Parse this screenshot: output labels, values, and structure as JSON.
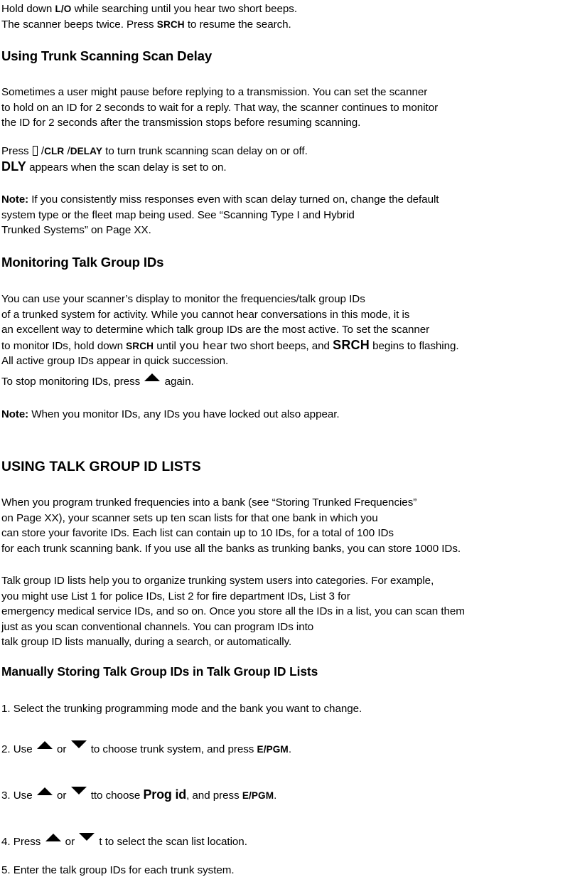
{
  "document": {
    "type": "scanner-owners-manual-page",
    "paragraphs": {
      "intro": {
        "line1_a": "Hold down ",
        "line1_key": "L/O",
        "line1_b": " while searching until you hear two short beeps.",
        "line2_a": "The scanner beeps twice. Press ",
        "line2_key": "SRCH",
        "line2_b": " to resume the search."
      },
      "scan_delay_heading": "Using Trunk Scanning Scan Delay",
      "scan_delay_body": {
        "line1": "Sometimes a user might pause before replying to a transmission. You can set the scanner",
        "line2": "to hold on an ID for 2 seconds to wait for a reply. That way, the scanner continues to monitor",
        "line3": "the ID for 2 seconds after the transmission stops before resuming scanning."
      },
      "press_delay": {
        "a": "Press ",
        "tofu": "□",
        "b": " /",
        "key1": "CLR",
        "c": " /",
        "key2": "DELAY",
        "d": " to turn trunk scanning scan delay on or off.",
        "dly_key": "DLY",
        "dly_rest": " appears when the scan delay is set to on."
      },
      "note_delay": {
        "label": "Note:",
        "line1": " If you consistently miss responses even with scan delay turned on, change the default",
        "line2": "system type or the fleet map being used. See “Scanning Type I and Hybrid",
        "line3": "Trunked Systems” on Page XX."
      },
      "monitoring_heading": "Monitoring Talk Group IDs",
      "monitoring_body": {
        "line1": "You can use your scanner’s display to monitor the frequencies/talk group IDs",
        "line2": "of a trunked system for activity. While you cannot hear conversations in this mode, it is",
        "line3": "an excellent way to determine which talk group IDs are the most active. To set the scanner",
        "line4_a": "to monitor IDs, hold down ",
        "line4_key1": "SRCH",
        "line4_b": " until ",
        "line4_alt": "you hear",
        "line4_c": " two short beeps, and ",
        "line4_key2": "SRCH",
        "line4_d": " begins to flashing.",
        "line5": "All active group IDs appear in quick succession."
      },
      "stop_monitoring": {
        "a": "To stop monitoring IDs, press ",
        "arrow": "up-triangle",
        "b": "  again."
      },
      "note_monitor": {
        "label": "Note:",
        "text": " When you monitor IDs, any IDs you have locked out also appear."
      },
      "using_lists_heading": "USING TALK GROUP ID LISTS",
      "using_lists_body": {
        "line1": "When you program trunked frequencies into a bank (see “Storing Trunked Frequencies”",
        "line2": "on Page XX), your scanner sets up ten scan lists for that one bank in which you",
        "line3": "can store your favorite IDs. Each list can contain up to 10 IDs, for a total of 100 IDs",
        "line4": "for each trunk scanning bank. If you use all the banks as trunking banks, you can store 1000 IDs."
      },
      "lists_categories": {
        "line1": "Talk group ID lists help you to organize trunking system users into categories. For example,",
        "line2": "you might use List 1 for police IDs, List 2 for fire department IDs, List 3 for",
        "line3": "emergency medical service IDs, and so on. Once you store all the IDs in a list, you can scan them",
        "line4": "just as you scan conventional channels. You can program IDs into",
        "line5": "talk group ID lists manually, during a search, or automatically."
      },
      "manual_storing_heading": "Manually Storing Talk Group IDs in Talk Group ID Lists"
    },
    "steps": [
      {
        "number": "1.",
        "text": " Select the trunking programming mode and the bank you want to change."
      },
      {
        "number": "2.",
        "lead": " Use ",
        "arrow_up": "up-triangle",
        "mid": "  or ",
        "arrow_down": "down-triangle",
        "tail_a": "  to choose trunk system, and press ",
        "key": "E/PGM",
        "tail_b": "."
      },
      {
        "number": "3.",
        "lead": " Use ",
        "arrow_up": "up-triangle",
        "mid": "  or ",
        "arrow_down": "down-triangle",
        "tail_a": "  tto choose ",
        "emphasis": "Prog id",
        "tail_b": ", and press ",
        "key": "E/PGM",
        "tail_c": "."
      },
      {
        "number": "4.",
        "lead": " Press ",
        "arrow_up": "up-triangle",
        "mid": "  or ",
        "arrow_down": "down-triangle",
        "tail_a": " t to select the scan list location."
      },
      {
        "number": "5.",
        "text": " Enter the talk group IDs for each trunk system."
      }
    ],
    "colors": {
      "text": "#000000",
      "background": "#ffffff"
    }
  }
}
